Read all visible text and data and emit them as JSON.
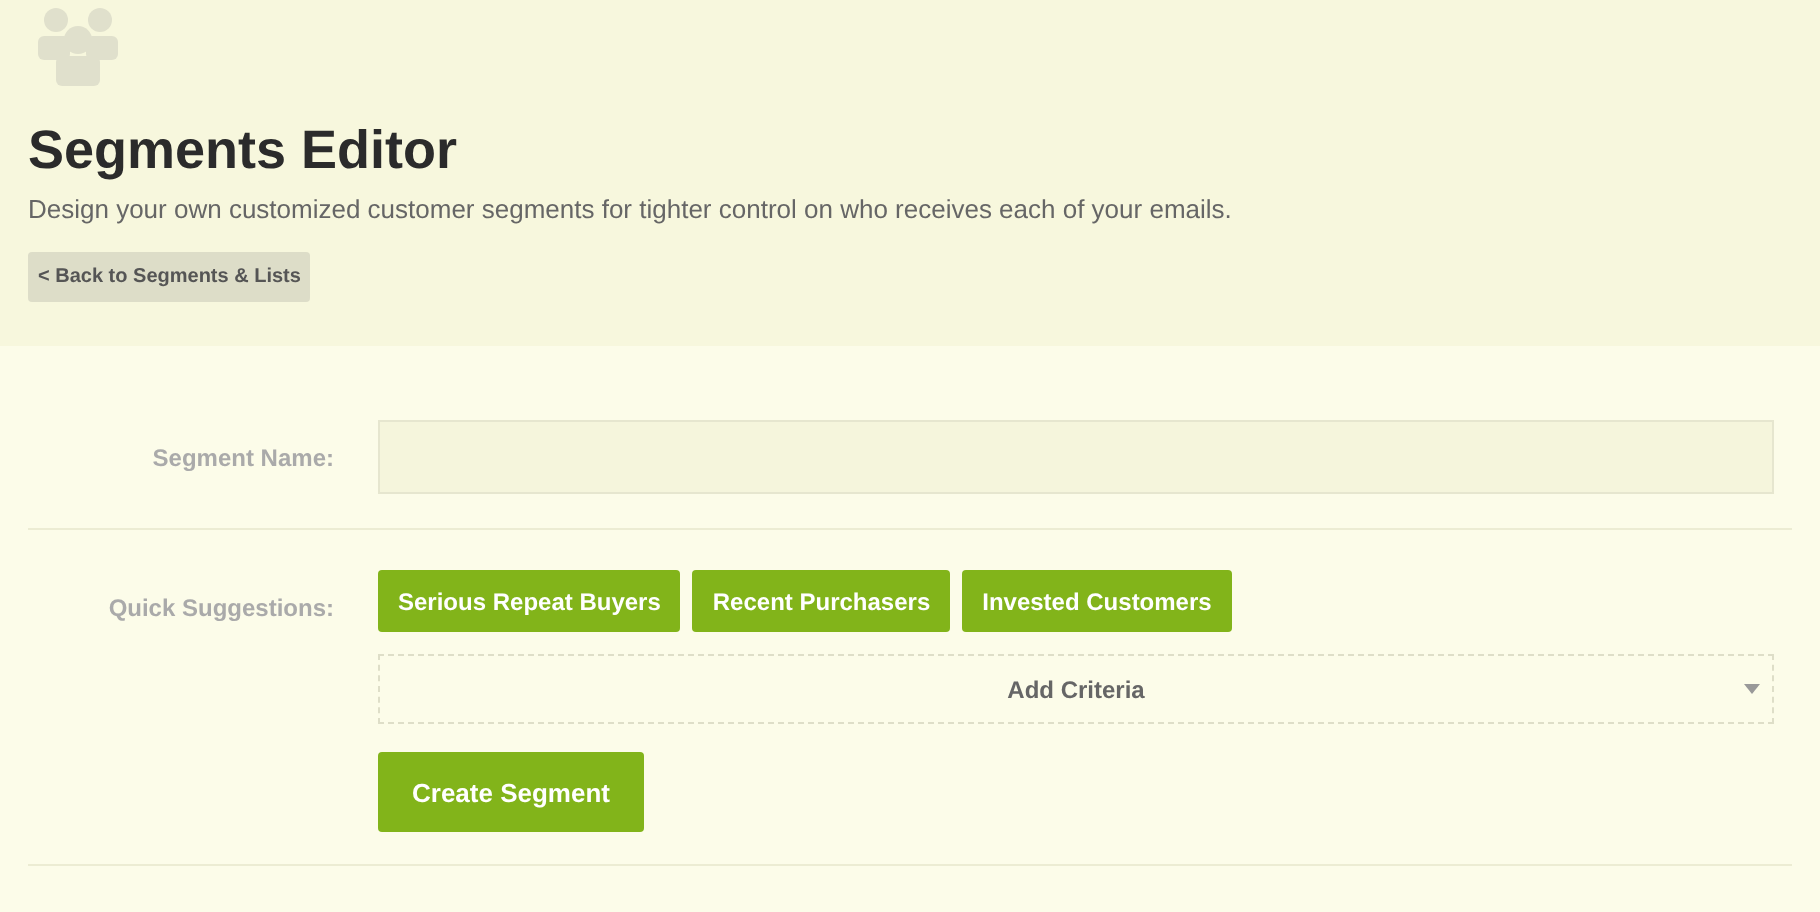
{
  "header": {
    "title": "Segments Editor",
    "subtitle": "Design your own customized customer segments for tighter control on who receives each of your emails.",
    "back_button": "< Back to Segments & Lists"
  },
  "form": {
    "name_label": "Segment Name:",
    "suggestions_label": "Quick Suggestions:",
    "suggestions": [
      "Serious Repeat Buyers",
      "Recent Purchasers",
      "Invested Customers"
    ],
    "criteria_dropdown": "Add Criteria",
    "submit_button": "Create Segment"
  }
}
